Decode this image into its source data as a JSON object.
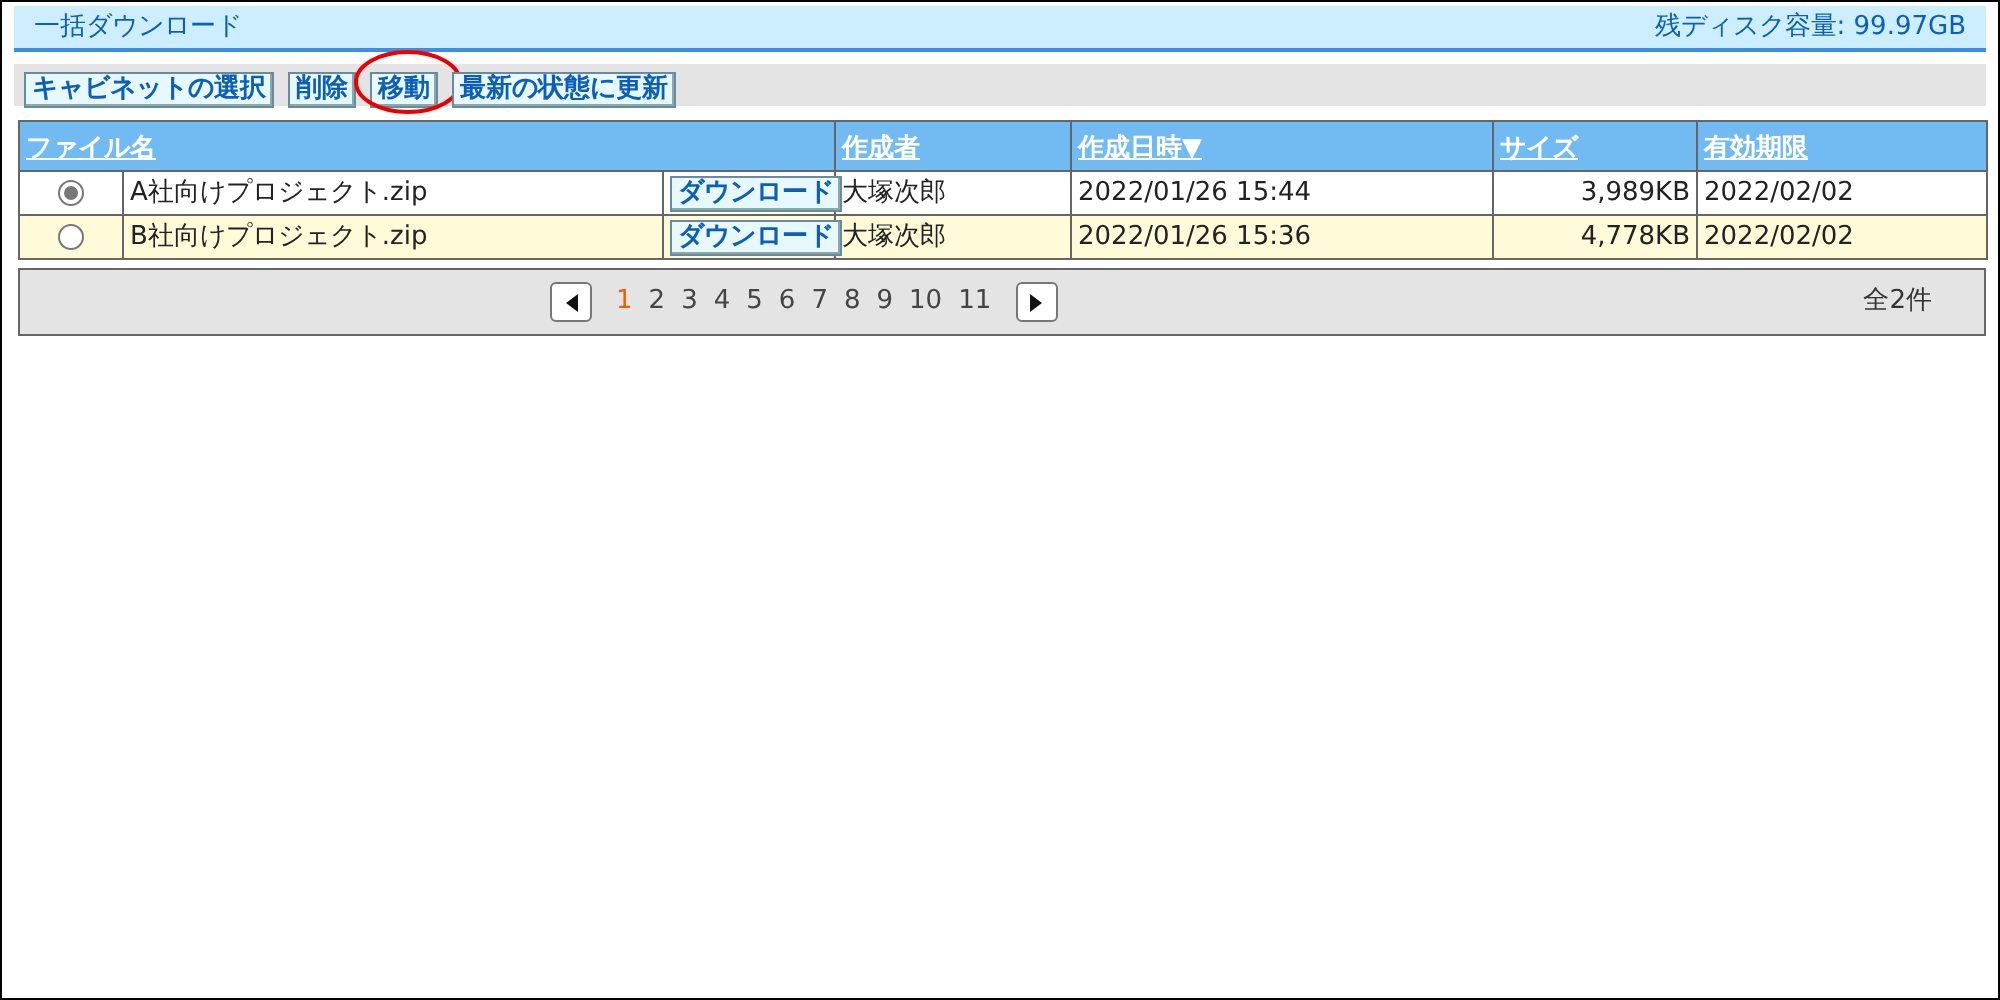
{
  "title": "一括ダウンロード",
  "disk_space": "残ディスク容量: 99.97GB",
  "toolbar": [
    {
      "label": "キャビネットの選択",
      "highlighted": false
    },
    {
      "label": "削除",
      "highlighted": false
    },
    {
      "label": "移動",
      "highlighted": true
    },
    {
      "label": "最新の状態に更新",
      "highlighted": false
    }
  ],
  "table": {
    "columns": [
      "ファイル名",
      "作成者",
      "作成日時▼",
      "サイズ",
      "有効期限"
    ],
    "rows": [
      {
        "selected": true,
        "file": "A社向けプロジェクト.zip",
        "download": "ダウンロード",
        "author": "大塚次郎",
        "created": "2022/01/26 15:44",
        "size": "3,989KB",
        "expires": "2022/02/02"
      },
      {
        "selected": false,
        "file": "B社向けプロジェクト.zip",
        "download": "ダウンロード",
        "author": "大塚次郎",
        "created": "2022/01/26 15:36",
        "size": "4,778KB",
        "expires": "2022/02/02"
      }
    ]
  },
  "pagination": {
    "pages": [
      {
        "label": "1",
        "selected": true
      },
      {
        "label": "2",
        "selected": false
      },
      {
        "label": "3",
        "selected": false
      },
      {
        "label": "4",
        "selected": false
      },
      {
        "label": "5",
        "selected": false
      },
      {
        "label": "6",
        "selected": false
      },
      {
        "label": "7",
        "selected": false
      },
      {
        "label": "8",
        "selected": false
      },
      {
        "label": "9",
        "selected": false
      },
      {
        "label": "10",
        "selected": false
      },
      {
        "label": "11",
        "selected": false
      }
    ],
    "total": "全2件"
  }
}
